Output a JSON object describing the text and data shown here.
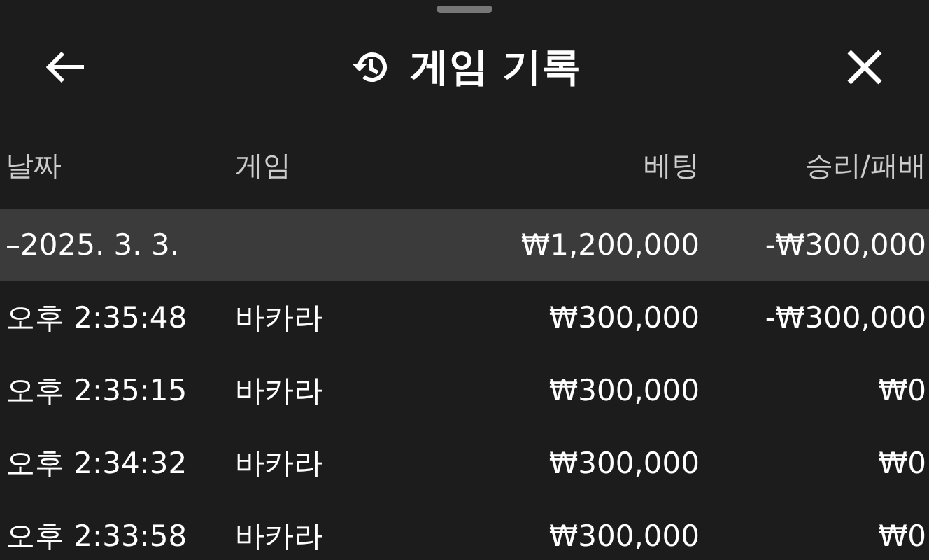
{
  "header": {
    "title": "게임 기록"
  },
  "table": {
    "columns": [
      "날짜",
      "게임",
      "베팅",
      "승리/패배"
    ],
    "summary": {
      "date": "–2025. 3. 3.",
      "bet": "₩1,200,000",
      "result": "-₩300,000"
    },
    "rows": [
      {
        "time": "오후 2:35:48",
        "game": "바카라",
        "bet": "₩300,000",
        "result": "-₩300,000"
      },
      {
        "time": "오후 2:35:15",
        "game": "바카라",
        "bet": "₩300,000",
        "result": "₩0"
      },
      {
        "time": "오후 2:34:32",
        "game": "바카라",
        "bet": "₩300,000",
        "result": "₩0"
      },
      {
        "time": "오후 2:33:58",
        "game": "바카라",
        "bet": "₩300,000",
        "result": "₩0"
      }
    ]
  }
}
